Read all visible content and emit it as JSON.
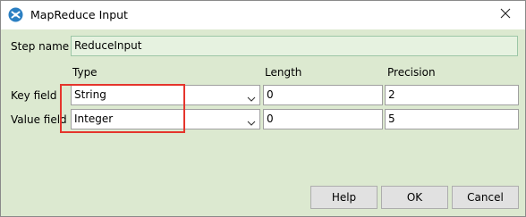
{
  "window": {
    "title": "MapReduce Input",
    "app_icon": "kettle-spoon-icon",
    "close_icon": "close-icon"
  },
  "step_name": {
    "label": "Step name",
    "value": "ReduceInput"
  },
  "columns": {
    "type": "Type",
    "length": "Length",
    "precision": "Precision"
  },
  "rows": [
    {
      "label": "Key field",
      "type": "String",
      "length": "0",
      "precision": "2"
    },
    {
      "label": "Value field",
      "type": "Integer",
      "length": "0",
      "precision": "5"
    }
  ],
  "buttons": {
    "help": "Help",
    "ok": "OK",
    "cancel": "Cancel"
  },
  "colors": {
    "background": "#dce9d0",
    "highlight_border": "#e5352c"
  }
}
